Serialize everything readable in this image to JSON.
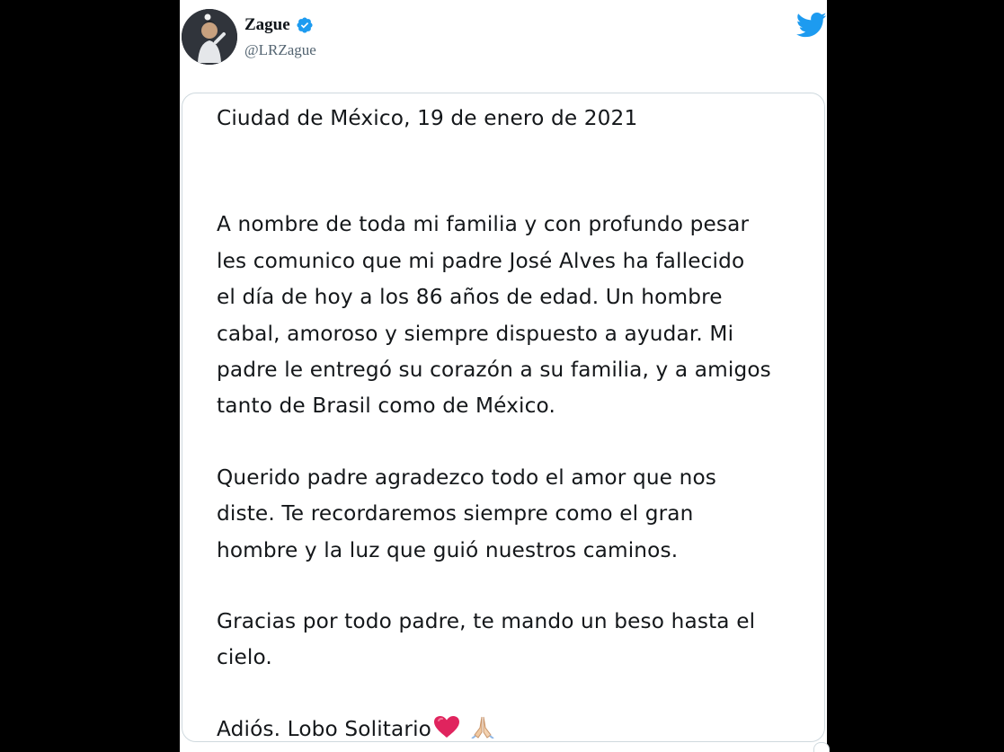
{
  "author": {
    "name": "Zague",
    "handle": "@LRZague",
    "verified_icon": "verified-badge-icon",
    "avatar_icon": "profile-photo"
  },
  "brand": {
    "logo_icon": "twitter-bird-icon",
    "accent": "#1d9bf0"
  },
  "letter": {
    "date_line": "Ciudad de México, 19 de enero de 2021",
    "paragraph1": [
      "A nombre de toda mi familia y con profundo pesar",
      "les comunico que mi padre José Alves ha fallecido",
      "el día de hoy a los 86 años de edad. Un hombre",
      "cabal, amoroso y siempre dispuesto a ayudar. Mi",
      "padre le entregó su corazón a su familia, y a amigos",
      "tanto de Brasil como de México."
    ],
    "paragraph2": [
      "Querido padre agradezco todo el amor que nos",
      "diste. Te recordaremos siempre como el gran",
      "hombre y la luz que guió nuestros caminos."
    ],
    "paragraph3": [
      "Gracias por todo padre, te mando un beso hasta el",
      "cielo."
    ],
    "closing": "Adiós. Lobo Solitario",
    "closing_emojis": [
      "red-heart-icon",
      "folded-hands-icon"
    ]
  }
}
